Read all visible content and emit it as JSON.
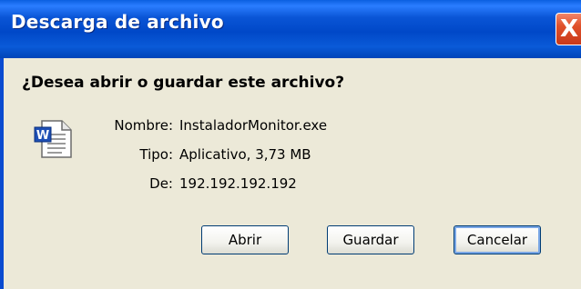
{
  "window": {
    "title": "Descarga de archivo",
    "close_label": "X"
  },
  "dialog": {
    "question": "¿Desea abrir o guardar este archivo?",
    "file_icon": "word-document-icon",
    "fields": {
      "name_label": "Nombre:",
      "name_value": "InstaladorMonitor.exe",
      "type_label": "Tipo:",
      "type_value": "Aplicativo, 3,73 MB",
      "from_label": "De:",
      "from_value": "192.192.192.192"
    }
  },
  "buttons": {
    "open": "Abrir",
    "save": "Guardar",
    "cancel": "Cancelar"
  },
  "colors": {
    "title_bar": "#0048c8",
    "close_button": "#e0502a",
    "dialog_bg": "#ece9d8"
  }
}
